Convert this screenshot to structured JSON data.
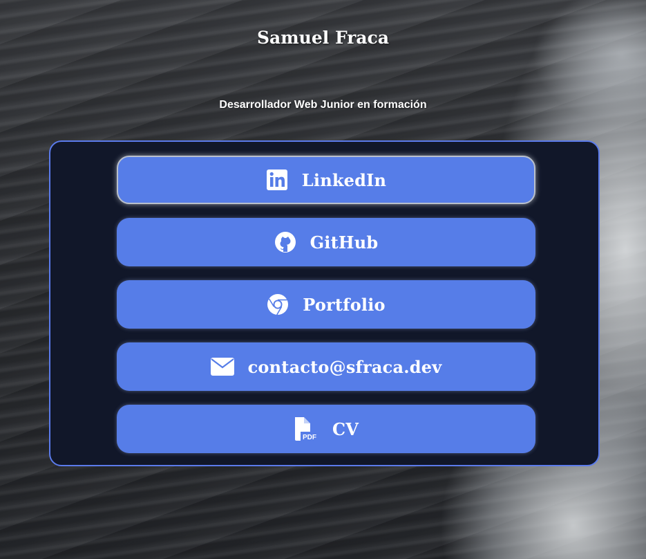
{
  "header": {
    "name": "Samuel Fraca",
    "tagline": "Desarrollador Web Junior en formación"
  },
  "links": [
    {
      "label": "LinkedIn",
      "icon": "linkedin-icon"
    },
    {
      "label": "GitHub",
      "icon": "github-icon"
    },
    {
      "label": "Portfolio",
      "icon": "chrome-icon"
    },
    {
      "label": "contacto@sfraca.dev",
      "icon": "envelope-icon"
    },
    {
      "label": "CV",
      "icon": "pdf-file-icon"
    }
  ],
  "colors": {
    "button": "#567de8",
    "card": "#111729",
    "card_border": "#5b7bec",
    "text": "#ffffff"
  }
}
